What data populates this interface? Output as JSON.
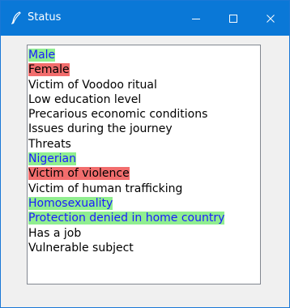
{
  "window": {
    "title": "Status",
    "accent": "#0a78d7"
  },
  "colors": {
    "green": "#90ee90",
    "red": "#f26d6d",
    "blue_text": "#1a1aff",
    "black_text": "#000000"
  },
  "list": {
    "items": [
      {
        "label": "Male",
        "bg": "#90ee90",
        "fg": "#1a1aff"
      },
      {
        "label": "Female",
        "bg": "#f26d6d",
        "fg": "#000000"
      },
      {
        "label": "Victim of Voodoo ritual",
        "bg": "",
        "fg": "#000000"
      },
      {
        "label": "Low education level",
        "bg": "",
        "fg": "#000000"
      },
      {
        "label": "Precarious economic conditions",
        "bg": "",
        "fg": "#000000"
      },
      {
        "label": "Issues during the journey",
        "bg": "",
        "fg": "#000000"
      },
      {
        "label": "Threats",
        "bg": "",
        "fg": "#000000"
      },
      {
        "label": "Nigerian",
        "bg": "#90ee90",
        "fg": "#1a1aff"
      },
      {
        "label": "Victim of violence",
        "bg": "#f26d6d",
        "fg": "#000000"
      },
      {
        "label": "Victim of human trafficking",
        "bg": "",
        "fg": "#000000"
      },
      {
        "label": "Homosexuality",
        "bg": "#90ee90",
        "fg": "#1a1aff"
      },
      {
        "label": "Protection denied in home country",
        "bg": "#90ee90",
        "fg": "#1a1aff"
      },
      {
        "label": "Has a job",
        "bg": "",
        "fg": "#000000"
      },
      {
        "label": "Vulnerable subject",
        "bg": "",
        "fg": "#000000"
      }
    ]
  }
}
